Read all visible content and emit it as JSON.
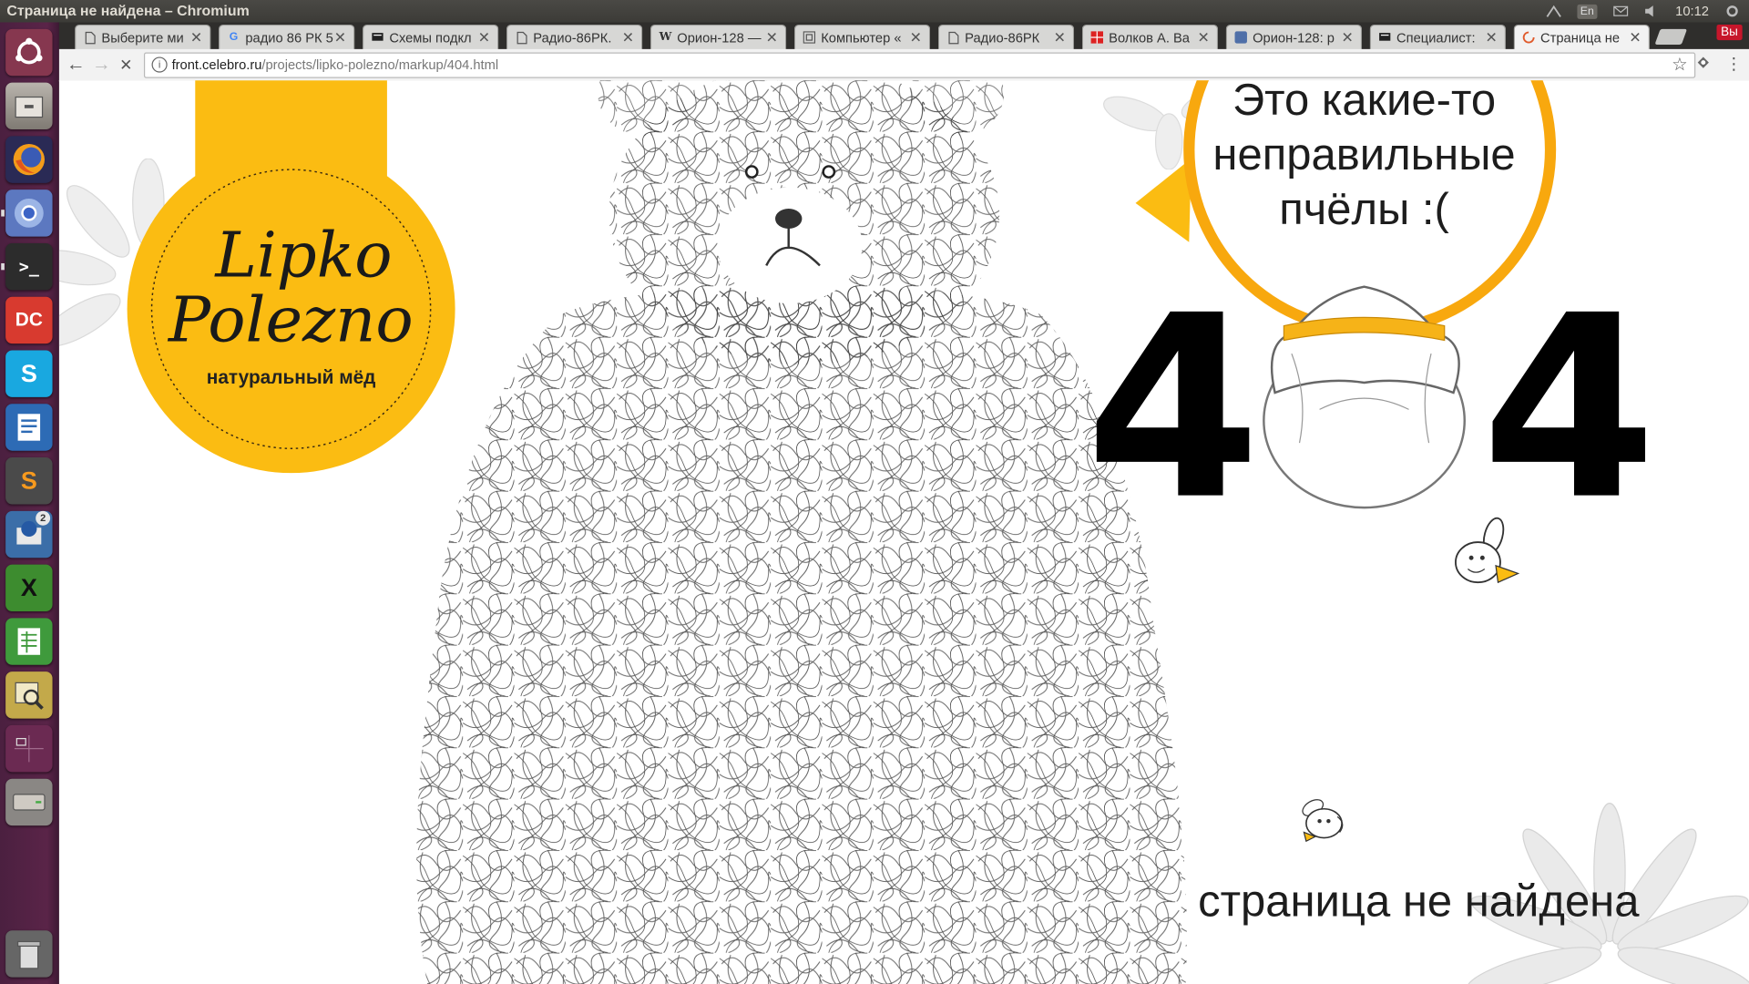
{
  "window": {
    "title": "Страница не найдена – Chromium"
  },
  "tray": {
    "lang": "En",
    "time": "10:12",
    "session": "Вы"
  },
  "launcher": {
    "items": [
      {
        "name": "ubuntu-dash",
        "glyph": ""
      },
      {
        "name": "files",
        "glyph": ""
      },
      {
        "name": "firefox",
        "glyph": ""
      },
      {
        "name": "chromium",
        "glyph": ""
      },
      {
        "name": "terminal",
        "glyph": ">_"
      },
      {
        "name": "doublecmd",
        "glyph": "DC"
      },
      {
        "name": "skype",
        "glyph": "S"
      },
      {
        "name": "writer",
        "glyph": ""
      },
      {
        "name": "sublime",
        "glyph": "S"
      },
      {
        "name": "thunderbird",
        "glyph": ""
      },
      {
        "name": "xmind",
        "glyph": "X"
      },
      {
        "name": "calc",
        "glyph": ""
      },
      {
        "name": "image-viewer",
        "glyph": ""
      },
      {
        "name": "workspaces",
        "glyph": ""
      },
      {
        "name": "drive",
        "glyph": ""
      },
      {
        "name": "trash",
        "glyph": ""
      }
    ],
    "thunderbird_badge": "2"
  },
  "tabs": [
    {
      "label": "Выберите ми",
      "favicon": "page-icon",
      "active": false
    },
    {
      "label": "радио 86 РК 5",
      "favicon": "google-icon",
      "active": false
    },
    {
      "label": "Схемы подкл",
      "favicon": "keyboard-icon",
      "active": false
    },
    {
      "label": "Радио-86РК.",
      "favicon": "page-icon",
      "active": false
    },
    {
      "label": "Орион-128 —",
      "favicon": "wikipedia-icon",
      "active": false
    },
    {
      "label": "Компьютер «",
      "favicon": "frame-icon",
      "active": false
    },
    {
      "label": "Радио-86РК",
      "favicon": "page-icon",
      "active": false
    },
    {
      "label": "Волков А. Ва",
      "favicon": "red-grid-icon",
      "active": false
    },
    {
      "label": "Орион-128: р",
      "favicon": "forum-icon",
      "active": false
    },
    {
      "label": "Специалист: ",
      "favicon": "keyboard-icon",
      "active": false
    },
    {
      "label": "Страница не ",
      "favicon": "loading-icon",
      "active": true
    }
  ],
  "toolbar": {
    "back": "←",
    "forward": "→",
    "stop": "✕",
    "url_host": "front.celebro.ru",
    "url_path": "/projects/lipko-polezno/markup/404.html",
    "star": "☆",
    "menu": "⋮"
  },
  "page": {
    "logo": {
      "line1": "Lipko",
      "line2": "Polezno",
      "subtitle": "натуральный мёд"
    },
    "speech_bubble": [
      "Это какие-то",
      "неправильные",
      "пчёлы :("
    ],
    "error_code_left": "4",
    "error_code_right": "4",
    "message": "страница не найдена",
    "colors": {
      "accent": "#fbbc12",
      "bubble_border": "#f8a80e",
      "text": "#1d1d1d"
    }
  }
}
